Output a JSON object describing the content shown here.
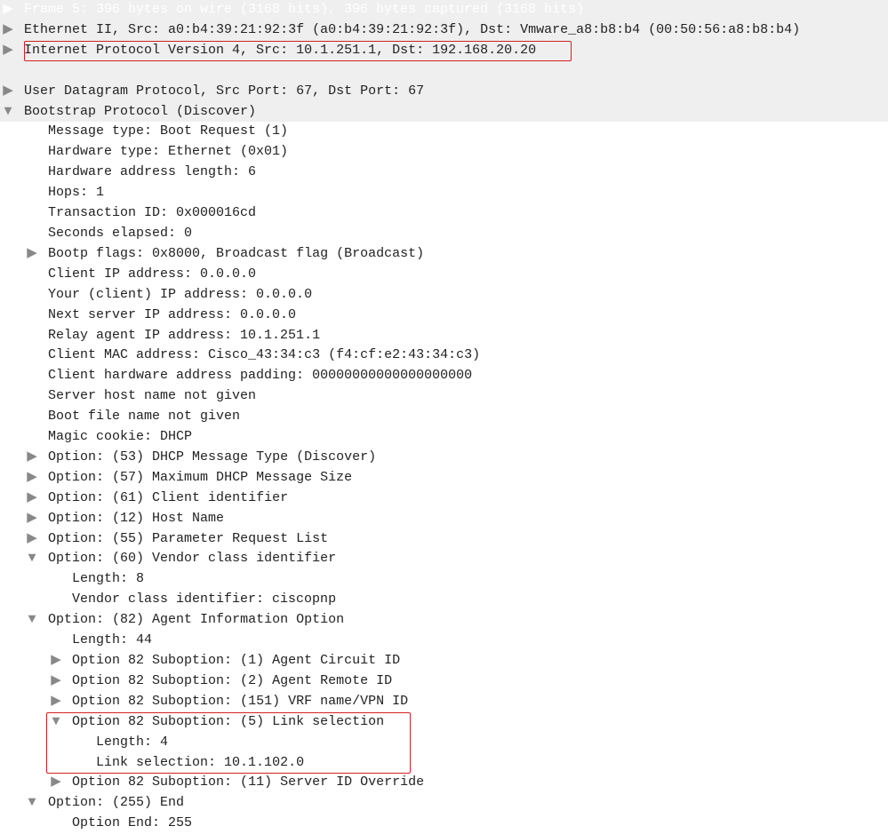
{
  "frame": {
    "summary": "Frame 5: 396 bytes on wire (3168 bits), 396 bytes captured (3168 bits)"
  },
  "ethernet": {
    "summary": "Ethernet II, Src: a0:b4:39:21:92:3f (a0:b4:39:21:92:3f), Dst: Vmware_a8:b8:b4 (00:50:56:a8:b8:b4)"
  },
  "ip": {
    "summary": "Internet Protocol Version 4, Src: 10.1.251.1, Dst: 192.168.20.20"
  },
  "udp": {
    "summary": "User Datagram Protocol, Src Port: 67, Dst Port: 67"
  },
  "bootp": {
    "summary": "Bootstrap Protocol (Discover)",
    "message_type": "Message type: Boot Request (1)",
    "hardware_type": "Hardware type: Ethernet (0x01)",
    "hw_addr_len": "Hardware address length: 6",
    "hops": "Hops: 1",
    "transaction_id": "Transaction ID: 0x000016cd",
    "seconds_elapsed": "Seconds elapsed: 0",
    "bootp_flags": "Bootp flags: 0x8000, Broadcast flag (Broadcast)",
    "client_ip": "Client IP address: 0.0.0.0",
    "your_ip": "Your (client) IP address: 0.0.0.0",
    "next_server_ip": "Next server IP address: 0.0.0.0",
    "relay_agent_ip": "Relay agent IP address: 10.1.251.1",
    "client_mac": "Client MAC address: Cisco_43:34:c3 (f4:cf:e2:43:34:c3)",
    "client_hw_pad": "Client hardware address padding: 00000000000000000000",
    "server_host": "Server host name not given",
    "boot_file": "Boot file name not given",
    "magic_cookie": "Magic cookie: DHCP",
    "opt53": "Option: (53) DHCP Message Type (Discover)",
    "opt57": "Option: (57) Maximum DHCP Message Size",
    "opt61": "Option: (61) Client identifier",
    "opt12": "Option: (12) Host Name",
    "opt55": "Option: (55) Parameter Request List",
    "opt60": {
      "summary": "Option: (60) Vendor class identifier",
      "length": "Length: 8",
      "vci": "Vendor class identifier: ciscopnp"
    },
    "opt82": {
      "summary": "Option: (82) Agent Information Option",
      "length": "Length: 44",
      "sub1": "Option 82 Suboption: (1) Agent Circuit ID",
      "sub2": "Option 82 Suboption: (2) Agent Remote ID",
      "sub151": "Option 82 Suboption: (151) VRF name/VPN ID",
      "sub5": {
        "summary": "Option 82 Suboption: (5) Link selection",
        "length": "Length: 4",
        "link": "Link selection: 10.1.102.0"
      },
      "sub11": "Option 82 Suboption: (11) Server ID Override"
    },
    "opt255": {
      "summary": "Option: (255) End",
      "end": "Option End: 255"
    }
  },
  "arrows": {
    "right": "▶",
    "down": "▼",
    "right_white": "▶"
  }
}
